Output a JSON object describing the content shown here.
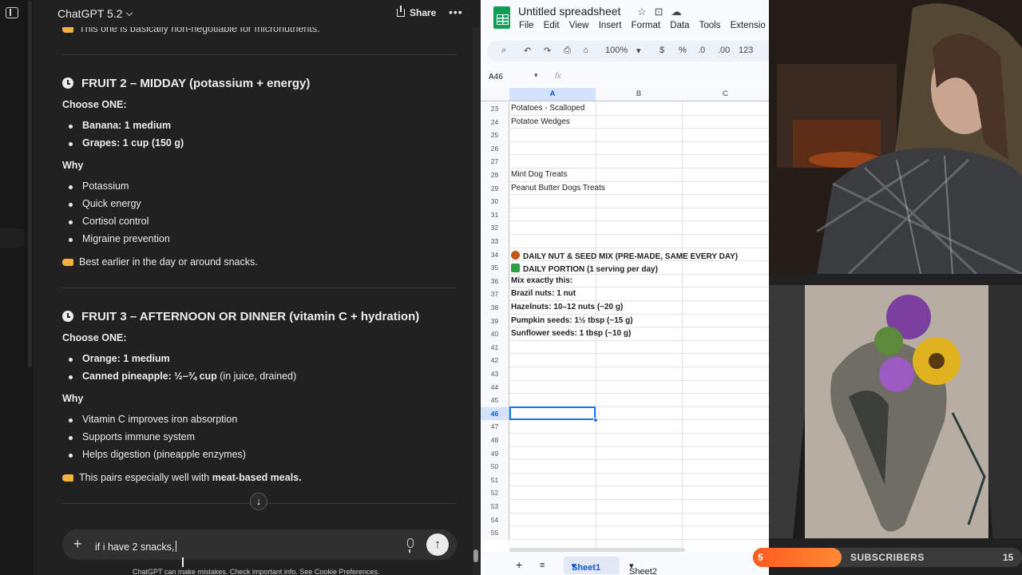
{
  "chatgpt": {
    "title": "ChatGPT 5.2",
    "share_label": "Share",
    "more_label": "•••",
    "top_cut_text": "This one is basically non-negotiable for micronutrients.",
    "fruit2": {
      "heading": "FRUIT 2 – MIDDAY (potassium + energy)",
      "choose": "Choose ONE:",
      "options": [
        "Banana: 1 medium",
        "Grapes: 1 cup (150 g)"
      ],
      "why": "Why",
      "reasons": [
        "Potassium",
        "Quick energy",
        "Cortisol control",
        "Migraine prevention"
      ],
      "tip": "Best earlier in the day or around snacks."
    },
    "fruit3": {
      "heading": "FRUIT 3 – AFTERNOON OR DINNER (vitamin C + hydration)",
      "choose": "Choose ONE:",
      "option1": "Orange: 1 medium",
      "option2_bold": "Canned pineapple: ½–¾ cup",
      "option2_rest": " (in juice, drained)",
      "why": "Why",
      "reasons": [
        "Vitamin C improves iron absorption",
        "Supports immune system",
        "Helps digestion (pineapple enzymes)"
      ],
      "tip_prefix": "This pairs especially well with ",
      "tip_bold": "meat-based meals."
    },
    "input_value": "if i have 2 snacks,",
    "disclaimer": "ChatGPT can make mistakes. Check important info. See Cookie Preferences.",
    "scroll_down_glyph": "↓",
    "send_glyph": "↑",
    "plus_glyph": "+"
  },
  "sheets": {
    "doc_title": "Untitled spreadsheet",
    "menu": [
      "File",
      "Edit",
      "View",
      "Insert",
      "Format",
      "Data",
      "Tools",
      "Extensio"
    ],
    "toolbar": {
      "zoom": "100%",
      "currency": "$",
      "percent": "%",
      "dec_less": ".0",
      "dec_more": ".00",
      "format": "123"
    },
    "name_box": "A46",
    "fx": "fx",
    "columns": [
      "A",
      "B",
      "C"
    ],
    "rows": [
      {
        "num": "23",
        "text": "Potatoes - Scalloped",
        "bold": false
      },
      {
        "num": "24",
        "text": "Potatoe Wedges",
        "bold": false
      },
      {
        "num": "25",
        "text": "",
        "bold": false
      },
      {
        "num": "26",
        "text": "",
        "bold": false
      },
      {
        "num": "27",
        "text": "",
        "bold": false
      },
      {
        "num": "28",
        "text": "Mint Dog Treats",
        "bold": false
      },
      {
        "num": "29",
        "text": "Peanut Butter Dogs Treats",
        "bold": false
      },
      {
        "num": "30",
        "text": "",
        "bold": false
      },
      {
        "num": "31",
        "text": "",
        "bold": false
      },
      {
        "num": "32",
        "text": "",
        "bold": false
      },
      {
        "num": "33",
        "text": "",
        "bold": false
      },
      {
        "num": "34",
        "text": "DAILY NUT & SEED MIX (PRE-MADE, SAME EVERY DAY)",
        "bold": true,
        "icon": "chestnut-icon"
      },
      {
        "num": "35",
        "text": "DAILY PORTION (1 serving per day)",
        "bold": true,
        "icon": "check-icon"
      },
      {
        "num": "36",
        "text": "Mix exactly this:",
        "bold": true
      },
      {
        "num": "37",
        "text": "Brazil nuts: 1 nut",
        "bold": true
      },
      {
        "num": "38",
        "text": "Hazelnuts: 10–12 nuts (~20 g)",
        "bold": true
      },
      {
        "num": "39",
        "text": "Pumpkin seeds: 1½ tbsp (~15 g)",
        "bold": true
      },
      {
        "num": "40",
        "text": "Sunflower seeds: 1 tbsp (~10 g)",
        "bold": true
      },
      {
        "num": "41",
        "text": "",
        "bold": false
      },
      {
        "num": "42",
        "text": "",
        "bold": false
      },
      {
        "num": "43",
        "text": "",
        "bold": false
      },
      {
        "num": "44",
        "text": "",
        "bold": false
      },
      {
        "num": "45",
        "text": "",
        "bold": false
      },
      {
        "num": "46",
        "text": "",
        "bold": false
      },
      {
        "num": "47",
        "text": "",
        "bold": false
      },
      {
        "num": "48",
        "text": "",
        "bold": false
      },
      {
        "num": "49",
        "text": "",
        "bold": false
      },
      {
        "num": "50",
        "text": "",
        "bold": false
      },
      {
        "num": "51",
        "text": "",
        "bold": false
      },
      {
        "num": "52",
        "text": "",
        "bold": false
      },
      {
        "num": "53",
        "text": "",
        "bold": false
      },
      {
        "num": "54",
        "text": "",
        "bold": false
      },
      {
        "num": "55",
        "text": "",
        "bold": false
      }
    ],
    "tabs": [
      "Sheet1",
      "Sheet2"
    ],
    "active_tab": "Sheet1"
  },
  "stream": {
    "subs_current": "5",
    "subs_label": "SUBSCRIBERS",
    "subs_goal": "15",
    "subs_progress": 0.33
  },
  "colors": {
    "chatgpt_bg": "#212121",
    "sheets_accent": "#1a73e8",
    "sheets_green": "#0f9d58",
    "subs_orange": "#ff5a1f"
  }
}
